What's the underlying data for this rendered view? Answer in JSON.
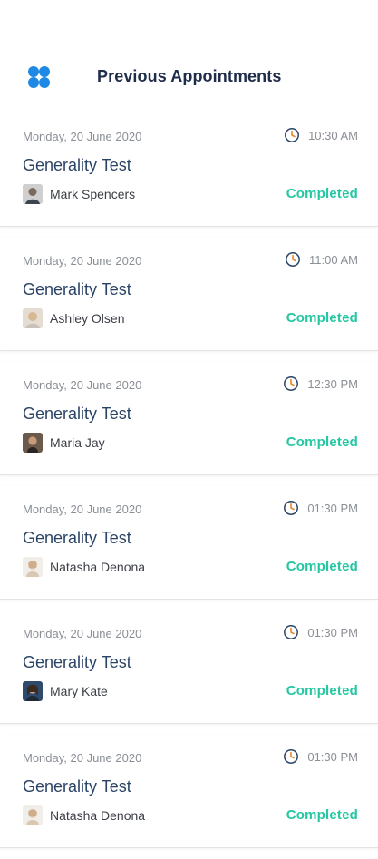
{
  "header": {
    "title": "Previous Appointments",
    "menu_icon": "grid-dots-icon",
    "accent_color": "#1e88e5"
  },
  "appointments": [
    {
      "date": "Monday, 20 June 2020",
      "time": "10:30 AM",
      "title": "Generality Test",
      "doctor": "Mark Spencers",
      "status": "Completed"
    },
    {
      "date": "Monday, 20 June 2020",
      "time": "11:00 AM",
      "title": "Generality Test",
      "doctor": "Ashley Olsen",
      "status": "Completed"
    },
    {
      "date": "Monday, 20 June 2020",
      "time": "12:30 PM",
      "title": "Generality Test",
      "doctor": "Maria Jay",
      "status": "Completed"
    },
    {
      "date": "Monday, 20 June 2020",
      "time": "01:30 PM",
      "title": "Generality Test",
      "doctor": "Natasha Denona",
      "status": "Completed"
    },
    {
      "date": "Monday, 20 June 2020",
      "time": "01:30 PM",
      "title": "Generality Test",
      "doctor": "Mary Kate",
      "status": "Completed"
    },
    {
      "date": "Monday, 20 June 2020",
      "time": "01:30 PM",
      "title": "Generality Test",
      "doctor": "Natasha Denona",
      "status": "Completed"
    }
  ],
  "colors": {
    "status_completed": "#25c6a2",
    "title": "#2b4466",
    "muted": "#8a8f96"
  }
}
